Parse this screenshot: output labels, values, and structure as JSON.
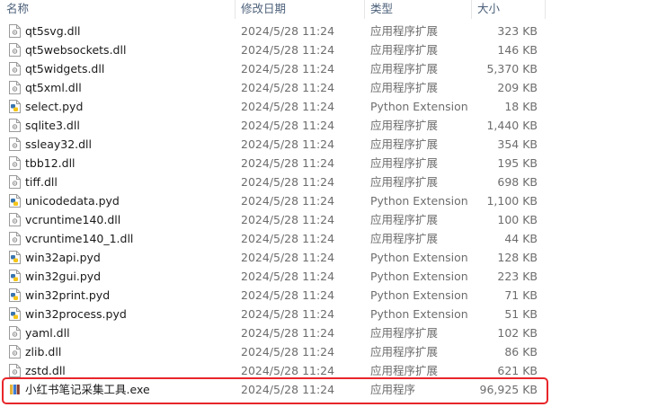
{
  "columns": {
    "name": "名称",
    "date": "修改日期",
    "type": "类型",
    "size": "大小"
  },
  "files": [
    {
      "name": "qt5svg.dll",
      "date": "2024/5/28 11:24",
      "type": "应用程序扩展",
      "size": "323 KB",
      "icon": "dll-file-icon"
    },
    {
      "name": "qt5websockets.dll",
      "date": "2024/5/28 11:24",
      "type": "应用程序扩展",
      "size": "146 KB",
      "icon": "dll-file-icon"
    },
    {
      "name": "qt5widgets.dll",
      "date": "2024/5/28 11:24",
      "type": "应用程序扩展",
      "size": "5,370 KB",
      "icon": "dll-file-icon"
    },
    {
      "name": "qt5xml.dll",
      "date": "2024/5/28 11:24",
      "type": "应用程序扩展",
      "size": "209 KB",
      "icon": "dll-file-icon"
    },
    {
      "name": "select.pyd",
      "date": "2024/5/28 11:24",
      "type": "Python Extension Module",
      "size": "18 KB",
      "icon": "python-file-icon"
    },
    {
      "name": "sqlite3.dll",
      "date": "2024/5/28 11:24",
      "type": "应用程序扩展",
      "size": "1,440 KB",
      "icon": "dll-file-icon"
    },
    {
      "name": "ssleay32.dll",
      "date": "2024/5/28 11:24",
      "type": "应用程序扩展",
      "size": "354 KB",
      "icon": "dll-file-icon"
    },
    {
      "name": "tbb12.dll",
      "date": "2024/5/28 11:24",
      "type": "应用程序扩展",
      "size": "195 KB",
      "icon": "dll-file-icon"
    },
    {
      "name": "tiff.dll",
      "date": "2024/5/28 11:24",
      "type": "应用程序扩展",
      "size": "698 KB",
      "icon": "dll-file-icon"
    },
    {
      "name": "unicodedata.pyd",
      "date": "2024/5/28 11:24",
      "type": "Python Extension Module",
      "size": "1,100 KB",
      "icon": "python-file-icon"
    },
    {
      "name": "vcruntime140.dll",
      "date": "2024/5/28 11:24",
      "type": "应用程序扩展",
      "size": "100 KB",
      "icon": "dll-file-icon"
    },
    {
      "name": "vcruntime140_1.dll",
      "date": "2024/5/28 11:24",
      "type": "应用程序扩展",
      "size": "44 KB",
      "icon": "dll-file-icon"
    },
    {
      "name": "win32api.pyd",
      "date": "2024/5/28 11:24",
      "type": "Python Extension Module",
      "size": "128 KB",
      "icon": "python-file-icon"
    },
    {
      "name": "win32gui.pyd",
      "date": "2024/5/28 11:24",
      "type": "Python Extension Module",
      "size": "223 KB",
      "icon": "python-file-icon"
    },
    {
      "name": "win32print.pyd",
      "date": "2024/5/28 11:24",
      "type": "Python Extension Module",
      "size": "71 KB",
      "icon": "python-file-icon"
    },
    {
      "name": "win32process.pyd",
      "date": "2024/5/28 11:24",
      "type": "Python Extension Module",
      "size": "51 KB",
      "icon": "python-file-icon"
    },
    {
      "name": "yaml.dll",
      "date": "2024/5/28 11:24",
      "type": "应用程序扩展",
      "size": "102 KB",
      "icon": "dll-file-icon"
    },
    {
      "name": "zlib.dll",
      "date": "2024/5/28 11:24",
      "type": "应用程序扩展",
      "size": "86 KB",
      "icon": "dll-file-icon"
    },
    {
      "name": "zstd.dll",
      "date": "2024/5/28 11:24",
      "type": "应用程序扩展",
      "size": "621 KB",
      "icon": "dll-file-icon"
    },
    {
      "name": "小红书笔记采集工具.exe",
      "date": "2024/5/28 11:24",
      "type": "应用程序",
      "size": "96,925 KB",
      "icon": "exe-app-icon"
    }
  ],
  "colors": {
    "highlight_border": "#e8262a",
    "header_text": "#4c607a",
    "secondary_text": "#6d6d6d",
    "python_blue": "#3a75b0",
    "python_yellow": "#f5c518"
  }
}
